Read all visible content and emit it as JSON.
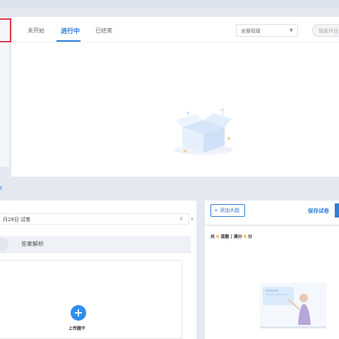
{
  "tabs": [
    {
      "label": "未开始"
    },
    {
      "label": "进行中"
    },
    {
      "label": "已结束"
    }
  ],
  "filters": {
    "grade_selected": "全部班级",
    "search_placeholder": "搜索作业名称"
  },
  "section": {
    "label": "t"
  },
  "paper": {
    "title_value": "月28日 试卷",
    "char_count": "8",
    "close_glyph": "x",
    "answer_tab": "答案解析",
    "upload_label": "上传题干"
  },
  "editor": {
    "add_label": "+ 添加大题",
    "save_label": "保存试卷",
    "stats_prefix": "共 ",
    "question_count": "0",
    "stats_mid": " 道题 | 满分 ",
    "total_score": "0",
    "stats_suffix": " 分"
  },
  "colors": {
    "accent": "#2f7ed8",
    "highlight_box": "#e0394a",
    "score_number": "#f0a020"
  },
  "icons": [
    "chevron-down-icon",
    "plus-icon",
    "empty-box-illustration",
    "teacher-board-illustration"
  ]
}
